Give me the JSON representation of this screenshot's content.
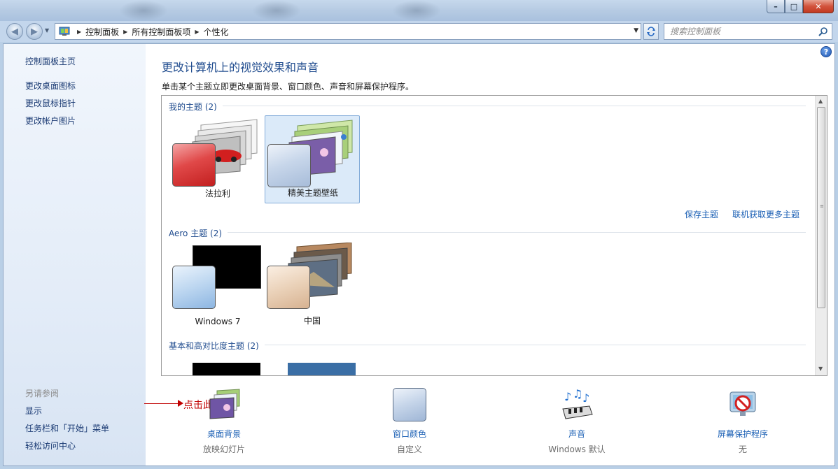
{
  "window": {
    "buttons": {
      "minimize": "–",
      "maximize": "□",
      "close": "✕"
    }
  },
  "nav": {
    "breadcrumb": [
      "控制面板",
      "所有控制面板项",
      "个性化"
    ],
    "search_placeholder": "搜索控制面板"
  },
  "sidebar": {
    "home": "控制面板主页",
    "links": [
      "更改桌面图标",
      "更改鼠标指针",
      "更改帐户图片"
    ],
    "see_also_title": "另请参阅",
    "see_also": [
      "显示",
      "任务栏和「开始」菜单",
      "轻松访问中心"
    ]
  },
  "annotation": "点击此处",
  "main": {
    "title": "更改计算机上的视觉效果和声音",
    "description": "单击某个主题立即更改桌面背景、窗口颜色、声音和屏幕保护程序。",
    "help": "?",
    "groups": {
      "my": "我的主题 (2)",
      "aero": "Aero 主题 (2)",
      "basic": "基本和高对比度主题 (2)"
    },
    "my_themes": [
      "法拉利",
      "精美主题壁纸"
    ],
    "aero_themes": [
      "Windows 7",
      "中国"
    ],
    "links": {
      "save": "保存主题",
      "more": "联机获取更多主题"
    }
  },
  "tools": [
    {
      "name": "桌面背景",
      "value": "放映幻灯片"
    },
    {
      "name": "窗口颜色",
      "value": "自定义"
    },
    {
      "name": "声音",
      "value": "Windows 默认"
    },
    {
      "name": "屏幕保护程序",
      "value": "无"
    }
  ],
  "colors": {
    "accent": "#1f4b8e",
    "link": "#1a5fb4",
    "annotation": "#c00000",
    "selected": "#dbeaf9"
  }
}
